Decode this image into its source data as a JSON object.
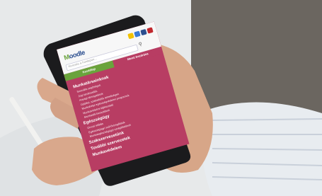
{
  "site": {
    "logo_prefix": "M",
    "logo_rest": "oodle",
    "search_placeholder": "Keresés a honlapon...",
    "tabs": [
      "Kezdőlap",
      "Menü bezárása"
    ],
    "badge_colors": [
      "#f2c200",
      "#3a7bd5",
      "#2c4f8f",
      "#c1272d"
    ]
  },
  "menu": {
    "sections": [
      {
        "heading": "Munkatársainknak",
        "items": [
          "Szociális segítségek",
          "Jogi tanácsadás",
          "Anyagi támogatások",
          "Üdülési, szabadidős lehetőségek",
          "Munkahelyi egészségvédelmi programok",
          "Munkavédelmi tájékoztató",
          "Munkaidő-beosztások"
        ]
      },
      {
        "heading": "Egészségügy",
        "items": [
          "Orvosi ellátás",
          "Egészségügyi szűrővizsgálatok",
          "Munkaegészségügyi szolgáltatások"
        ]
      },
      {
        "heading": "Szakszervezetünk",
        "items": []
      },
      {
        "heading": "További szervezetek",
        "items": []
      },
      {
        "heading": "Munkavédelem",
        "items": []
      }
    ]
  },
  "colors": {
    "accent": "#b83d63",
    "green": "#6aa33c",
    "logo": "#2c4f8f"
  }
}
